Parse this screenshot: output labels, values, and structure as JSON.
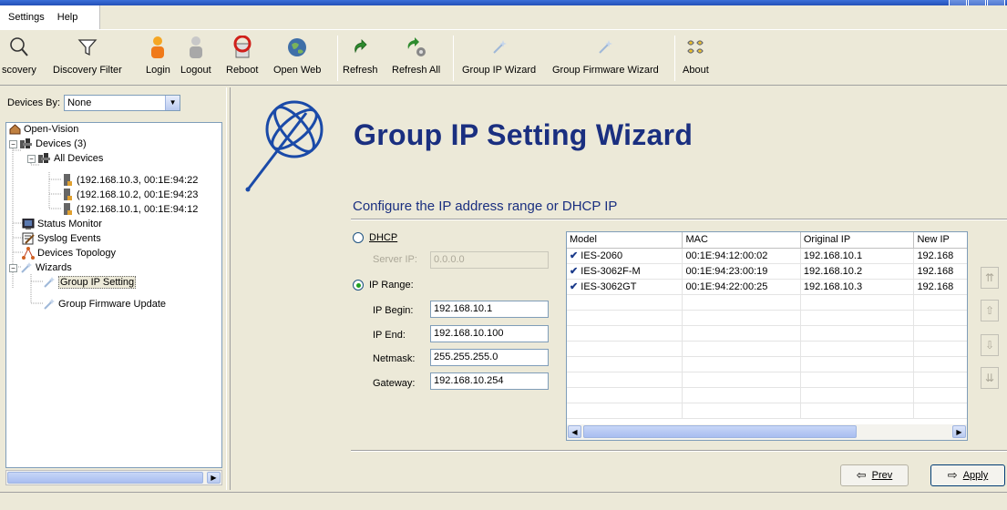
{
  "menu": {
    "settings": "Settings",
    "help": "Help"
  },
  "toolbar": {
    "discovery": "scovery",
    "discovery_filter": "Discovery Filter",
    "login": "Login",
    "logout": "Logout",
    "reboot": "Reboot",
    "open_web": "Open Web",
    "refresh": "Refresh",
    "refresh_all": "Refresh All",
    "group_ip_wizard": "Group IP Wizard",
    "group_firmware_wizard": "Group Firmware Wizard",
    "about": "About"
  },
  "sidebar": {
    "devices_by_label": "Devices By:",
    "devices_by_value": "None",
    "tree": {
      "root": "Open-Vision",
      "devices": "Devices (3)",
      "all_devices": "All Devices",
      "device_1": "(192.168.10.3, 00:1E:94:22",
      "device_2": "(192.168.10.2, 00:1E:94:23",
      "device_3": "(192.168.10.1, 00:1E:94:12",
      "status_monitor": "Status Monitor",
      "syslog_events": "Syslog Events",
      "devices_topology": "Devices Topology",
      "wizards": "Wizards",
      "group_ip_setting": "Group IP Setting",
      "group_firmware_update": "Group Firmware Update"
    }
  },
  "main": {
    "title": "Group IP Setting Wizard",
    "subtitle": "Configure the IP address range or DHCP IP",
    "dhcp_label": "DHCP",
    "server_ip_label": "Server IP:",
    "server_ip_value": "0.0.0.0",
    "ip_range_label": "IP Range:",
    "ip_begin_label": "IP Begin:",
    "ip_begin_value": "192.168.10.1",
    "ip_end_label": "IP End:",
    "ip_end_value": "192.168.10.100",
    "netmask_label": "Netmask:",
    "netmask_value": "255.255.255.0",
    "gateway_label": "Gateway:",
    "gateway_value": "192.168.10.254",
    "selected_mode": "ip_range"
  },
  "table": {
    "columns": [
      "Model",
      "MAC",
      "Original IP",
      "New IP"
    ],
    "rows": [
      {
        "model": "IES-2060",
        "mac": "00:1E:94:12:00:02",
        "orig_ip": "192.168.10.1",
        "new_ip": "192.168"
      },
      {
        "model": "IES-3062F-M",
        "mac": "00:1E:94:23:00:19",
        "orig_ip": "192.168.10.2",
        "new_ip": "192.168"
      },
      {
        "model": "IES-3062GT",
        "mac": "00:1E:94:22:00:25",
        "orig_ip": "192.168.10.3",
        "new_ip": "192.168"
      }
    ]
  },
  "buttons": {
    "prev": "Prev",
    "apply": "Apply"
  },
  "colors": {
    "title": "#1a2f80",
    "accent": "#2350b8"
  }
}
